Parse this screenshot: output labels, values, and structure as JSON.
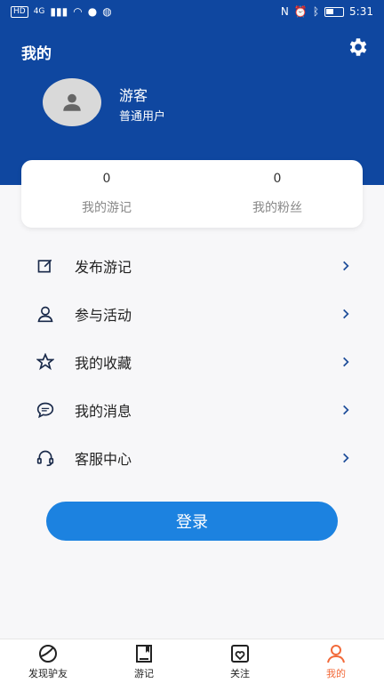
{
  "status_bar": {
    "left": "HD",
    "signal": "4G",
    "time": "5:31"
  },
  "header": {
    "title": "我的",
    "user_name": "游客",
    "user_role": "普通用户"
  },
  "stats": {
    "journals_count": "0",
    "journals_label": "我的游记",
    "fans_count": "0",
    "fans_label": "我的粉丝"
  },
  "menu": {
    "items": [
      {
        "label": "发布游记",
        "icon": "edit-icon"
      },
      {
        "label": "参与活动",
        "icon": "person-icon"
      },
      {
        "label": "我的收藏",
        "icon": "star-icon"
      },
      {
        "label": "我的消息",
        "icon": "chat-icon"
      },
      {
        "label": "客服中心",
        "icon": "headset-icon"
      }
    ]
  },
  "login_label": "登录",
  "bottom_nav": {
    "items": [
      {
        "label": "发现驴友",
        "icon": "discover-icon"
      },
      {
        "label": "游记",
        "icon": "book-icon"
      },
      {
        "label": "关注",
        "icon": "heart-card-icon"
      },
      {
        "label": "我的",
        "icon": "profile-icon"
      }
    ],
    "active": "我的"
  },
  "colors": {
    "primary": "#0f47a0",
    "button": "#1c82e0",
    "active_nav": "#f26a3a"
  }
}
